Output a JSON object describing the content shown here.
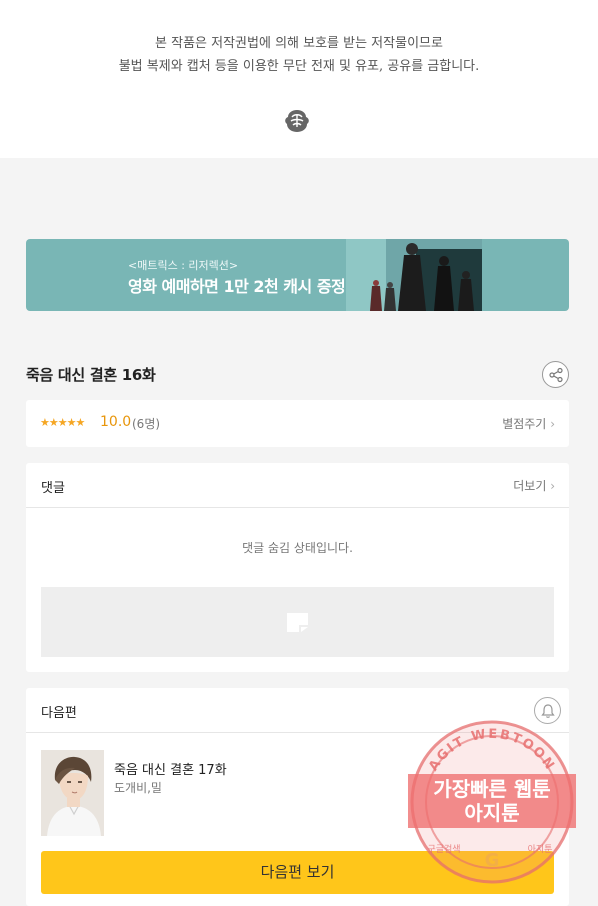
{
  "notice": {
    "line1": "본 작품은 저작권법에 의해 보호를 받는 저작물이므로",
    "line2": "불법 복제와 캡처 등을 이용한 무단 전재 및 유포, 공유를 금합니다."
  },
  "banner": {
    "sub": "<매트릭스 : 리저렉션>",
    "main": "영화 예매하면 1만 2천 캐시 증정!"
  },
  "episode": {
    "title": "죽음 대신 결혼 16화"
  },
  "rating": {
    "stars": "★★★★★",
    "score": "10.0",
    "count": "(6명)",
    "rate_link": "별점주기"
  },
  "comments": {
    "title": "댓글",
    "more": "더보기",
    "hidden_message": "댓글 숨김 상태입니다."
  },
  "next_episode": {
    "section_title": "다음편",
    "title": "죽음 대신 결혼 17화",
    "author": "도개비,밀",
    "button_label": "다음편 보기"
  },
  "watermark": {
    "arc_text": "AGIT WEBTOON",
    "line1": "가장빠른 웹툰",
    "line2": "아지툰",
    "bottom_left": "구글검색",
    "bottom_right": "아지툰"
  },
  "colors": {
    "accent_yellow": "#ffc61a",
    "banner_teal": "#79b6b5",
    "score_orange": "#e8960b"
  }
}
